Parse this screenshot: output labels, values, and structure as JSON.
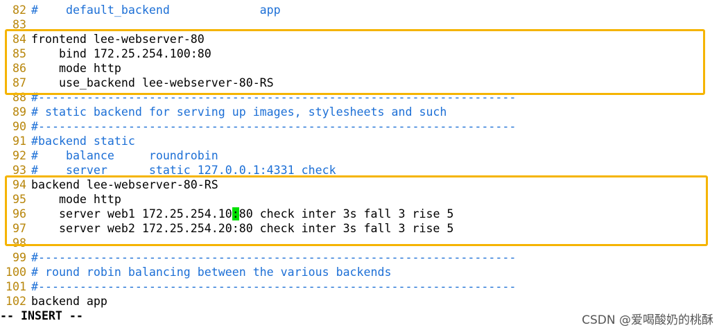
{
  "editor": {
    "lines": [
      {
        "num": "82",
        "text": "#    default_backend             app",
        "kind": "comment"
      },
      {
        "num": "83",
        "text": "",
        "kind": "code"
      },
      {
        "num": "84",
        "text": "frontend lee-webserver-80",
        "kind": "code"
      },
      {
        "num": "85",
        "text": "    bind 172.25.254.100:80",
        "kind": "code"
      },
      {
        "num": "86",
        "text": "    mode http",
        "kind": "code"
      },
      {
        "num": "87",
        "text": "    use_backend lee-webserver-80-RS",
        "kind": "code"
      },
      {
        "num": "88",
        "text": "#---------------------------------------------------------------------",
        "kind": "comment"
      },
      {
        "num": "89",
        "text": "# static backend for serving up images, stylesheets and such",
        "kind": "comment"
      },
      {
        "num": "90",
        "text": "#---------------------------------------------------------------------",
        "kind": "comment"
      },
      {
        "num": "91",
        "text": "#backend static",
        "kind": "comment"
      },
      {
        "num": "92",
        "text": "#    balance     roundrobin",
        "kind": "comment"
      },
      {
        "num": "93",
        "text": "#    server      static 127.0.0.1:4331 check",
        "kind": "comment"
      },
      {
        "num": "94",
        "text": "backend lee-webserver-80-RS",
        "kind": "code"
      },
      {
        "num": "95",
        "text": "    mode http",
        "kind": "code"
      },
      {
        "num": "96",
        "text": "    server web1 172.25.254.10",
        "after": "80 check inter 3s fall 3 rise 5",
        "cursor": ":",
        "kind": "code"
      },
      {
        "num": "97",
        "text": "    server web2 172.25.254.20:80 check inter 3s fall 3 rise 5",
        "kind": "code"
      },
      {
        "num": "98",
        "text": "",
        "kind": "code"
      },
      {
        "num": "99",
        "text": "#---------------------------------------------------------------------",
        "kind": "comment"
      },
      {
        "num": "100",
        "text": "# round robin balancing between the various backends",
        "kind": "comment"
      },
      {
        "num": "101",
        "text": "#---------------------------------------------------------------------",
        "kind": "comment"
      },
      {
        "num": "102",
        "text": "backend app",
        "kind": "code"
      }
    ]
  },
  "status": {
    "mode": "-- INSERT --"
  },
  "watermark": {
    "text": "CSDN @爱喝酸奶的桃酥"
  },
  "colors": {
    "line_number": "#b8860b",
    "comment": "#1c6fd6",
    "highlight_box": "#f5b400",
    "cursor": "#00e000"
  }
}
